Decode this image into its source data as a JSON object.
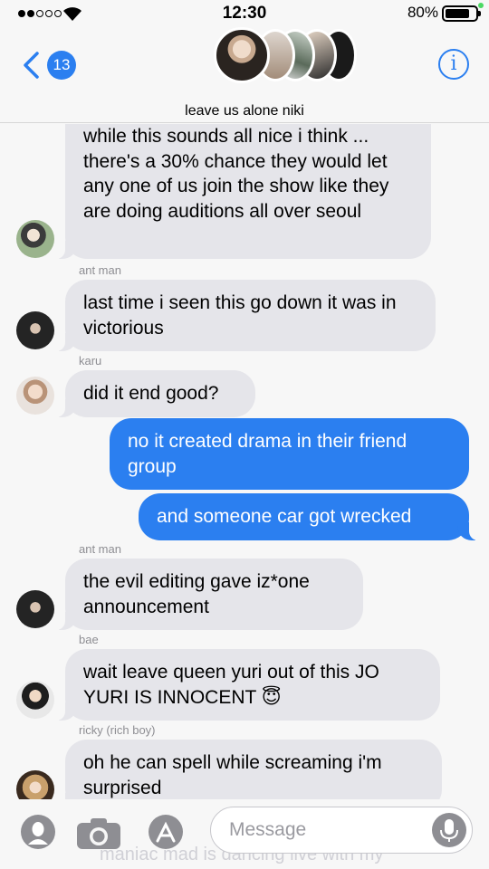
{
  "status_bar": {
    "time": "12:30",
    "battery_percent": "80%",
    "signal_bars_filled": 2,
    "signal_bars_total": 5,
    "battery_level": 0.8
  },
  "header": {
    "back_badge": "13",
    "group_name": "leave us alone niki",
    "back_icon": "chevron-left-icon",
    "info_icon": "info-icon",
    "info_glyph": "i"
  },
  "messages": [
    {
      "direction": "in",
      "text": "while this sounds all nice i think ... there's a 30% chance they would let any one of us join the show like they are doing auditions all over seoul"
    },
    {
      "direction": "in",
      "sender": "ant man",
      "text": "last time i seen this go down it was in victorious"
    },
    {
      "direction": "in",
      "sender": "karu",
      "text": "did it end good?"
    },
    {
      "direction": "out",
      "text": "no it created drama in their friend group"
    },
    {
      "direction": "out",
      "text": "and someone car got wrecked"
    },
    {
      "direction": "in",
      "sender": "ant man",
      "text": "the evil editing gave iz*one announcement"
    },
    {
      "direction": "in",
      "sender": "bae",
      "text": "wait leave queen yuri out of this JO YURI IS INNOCENT 😇"
    },
    {
      "direction": "in",
      "sender": "ricky (rich boy)",
      "text": "oh he can spell while screaming i'm surprised"
    }
  ],
  "composer": {
    "placeholder": "Message",
    "ghost_text": "maniac mad is dancing live with my",
    "icons": [
      "memoji-icon",
      "camera-icon",
      "app-store-icon",
      "microphone-icon"
    ]
  },
  "colors": {
    "outgoing_bubble": "#2b7ff0",
    "incoming_bubble": "#e5e5ea",
    "accent": "#2b7ff0",
    "background": "#f7f7f7"
  }
}
